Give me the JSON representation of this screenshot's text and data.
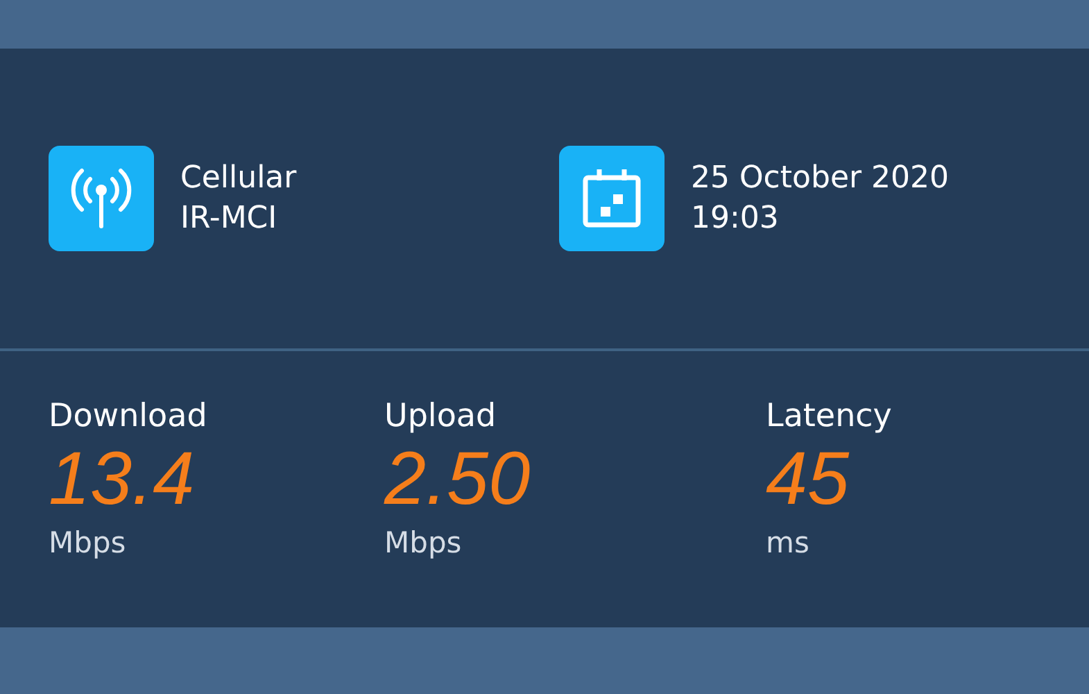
{
  "connection": {
    "type": "Cellular",
    "carrier": "IR-MCI"
  },
  "test_time": {
    "date": "25 October 2020",
    "time": "19:03"
  },
  "results": [
    {
      "label": "Download",
      "value": "13.4",
      "unit": "Mbps"
    },
    {
      "label": "Upload",
      "value": "2.50",
      "unit": "Mbps"
    },
    {
      "label": "Latency",
      "value": "45",
      "unit": "ms"
    }
  ]
}
